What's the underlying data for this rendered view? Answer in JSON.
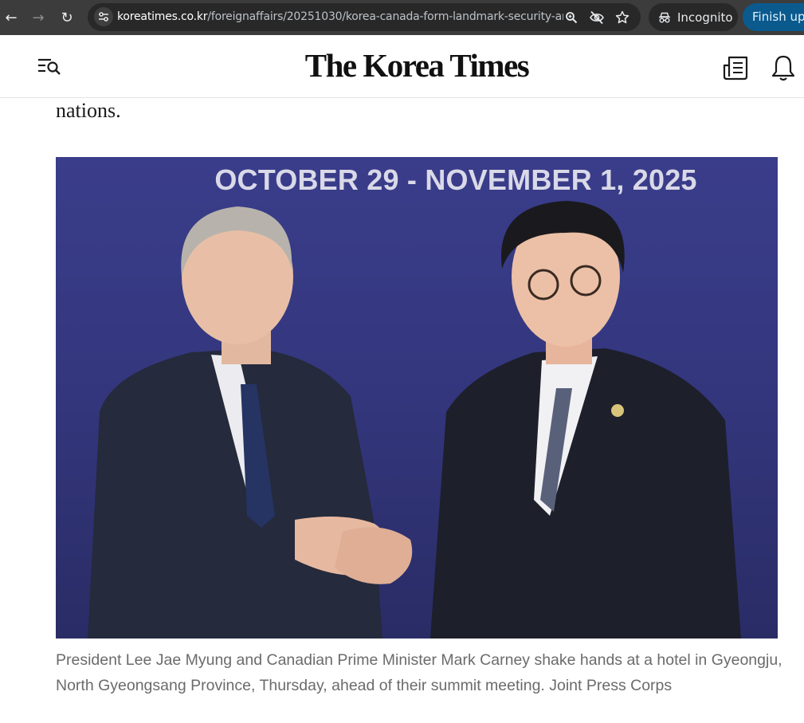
{
  "browser": {
    "url_host": "koreatimes.co.kr",
    "url_path": "/foreignaffairs/20251030/korea-canada-form-landmark-security-an...",
    "incognito_label": "Incognito",
    "update_button_label": "Finish update",
    "icons": [
      "back-icon",
      "forward-icon",
      "reload-icon",
      "site-settings-icon",
      "zoom-icon",
      "eye-off-icon",
      "star-icon",
      "incognito-icon"
    ]
  },
  "site": {
    "logo": "The Korea Times",
    "icons": [
      "menu-search-icon",
      "newspaper-icon",
      "bell-icon"
    ]
  },
  "article": {
    "text_fragment": "nations.",
    "photo_banner": "OCTOBER 29 - NOVEMBER 1, 2025",
    "caption": "President Lee Jae Myung and Canadian Prime Minister Mark Carney shake hands at a hotel in Gyeongju, North Gyeongsang Province, Thursday, ahead of their summit meeting. Joint Press Corps"
  },
  "colors": {
    "chrome_bg": "#3c3c3c",
    "omnibox_bg": "#282828",
    "update_button_bg": "#0a5a8e",
    "photo_backdrop": "#34377e",
    "caption_text": "#6b6b6b"
  }
}
